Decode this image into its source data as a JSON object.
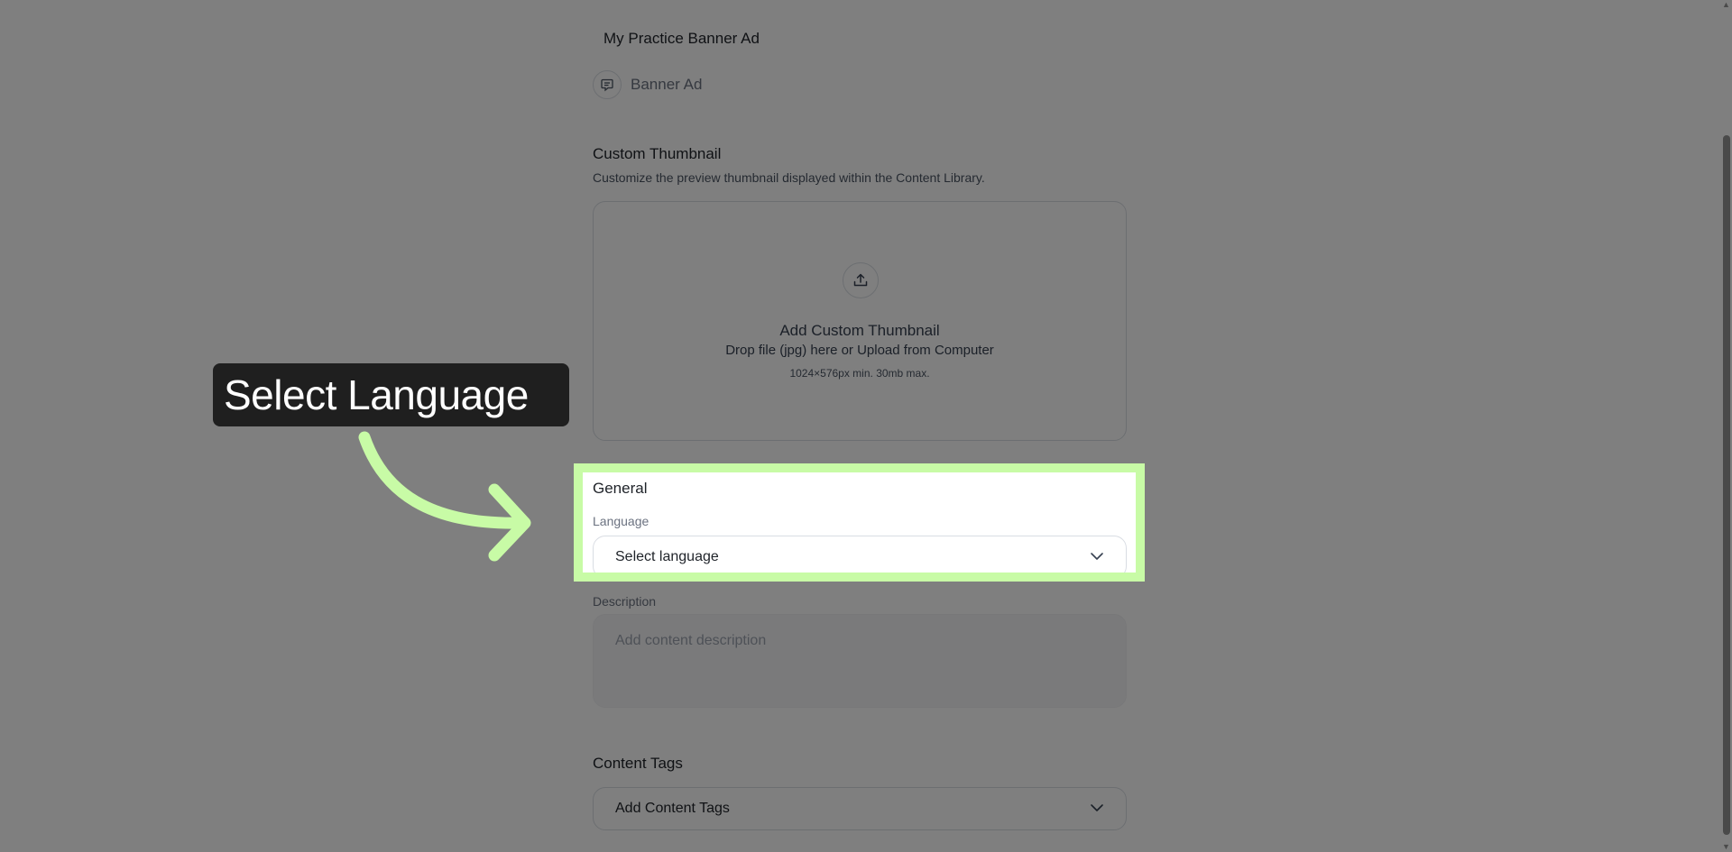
{
  "content": {
    "title": "My Practice Banner Ad",
    "type_label": "Banner Ad",
    "thumbnail": {
      "heading": "Custom Thumbnail",
      "description": "Customize the preview thumbnail displayed within the Content Library.",
      "drop_title": "Add Custom Thumbnail",
      "drop_subtitle": "Drop file (jpg) here or Upload from Computer",
      "drop_hint": "1024×576px min. 30mb max."
    },
    "general": {
      "heading": "General",
      "language_label": "Language",
      "language_placeholder": "Select language"
    },
    "description": {
      "label": "Description",
      "placeholder": "Add content description"
    },
    "tags": {
      "heading": "Content Tags",
      "placeholder": "Add Content Tags"
    }
  },
  "overlay": {
    "callout_text": "Select Language",
    "highlight_color": "#c8fba6",
    "callout_bg": "#1f1f1f"
  },
  "icons": {
    "type": "banner-ad-icon",
    "upload": "upload-icon",
    "chevron": "chevron-down-icon"
  }
}
